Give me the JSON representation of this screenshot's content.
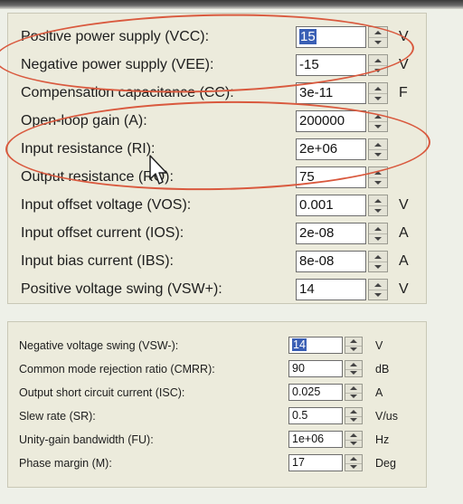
{
  "panel1": {
    "rows": [
      {
        "label": "Positive power supply (VCC):",
        "value": "15",
        "unit": "V",
        "selected": true
      },
      {
        "label": "Negative power supply (VEE):",
        "value": "-15",
        "unit": "V"
      },
      {
        "label": "Compensation capacitance (CC):",
        "value": "3e-11",
        "unit": "F"
      },
      {
        "label": "Open-loop gain (A):",
        "value": "200000",
        "unit": ""
      },
      {
        "label": "Input resistance (RI):",
        "value": "2e+06",
        "unit": ""
      },
      {
        "label": "Output resistance (RO):",
        "value": "75",
        "unit": ""
      },
      {
        "label": "Input offset voltage (VOS):",
        "value": "0.001",
        "unit": "V"
      },
      {
        "label": "Input offset current (IOS):",
        "value": "2e-08",
        "unit": "A"
      },
      {
        "label": "Input bias current (IBS):",
        "value": "8e-08",
        "unit": "A"
      },
      {
        "label": "Positive voltage swing (VSW+):",
        "value": "14",
        "unit": "V"
      }
    ]
  },
  "panel2": {
    "rows": [
      {
        "label": "Negative voltage swing (VSW-):",
        "value": "14",
        "unit": "V",
        "selected": true
      },
      {
        "label": "Common mode rejection ratio (CMRR):",
        "value": "90",
        "unit": "dB"
      },
      {
        "label": "Output short circuit current (ISC):",
        "value": "0.025",
        "unit": "A"
      },
      {
        "label": "Slew rate (SR):",
        "value": "0.5",
        "unit": "V/us"
      },
      {
        "label": "Unity-gain bandwidth (FU):",
        "value": "1e+06",
        "unit": "Hz"
      },
      {
        "label": "Phase margin (M):",
        "value": "17",
        "unit": "Deg"
      }
    ]
  },
  "colors": {
    "annotation": "#d9593e",
    "selection": "#3a5fb5",
    "panel": "#ecebdc"
  },
  "icons": {
    "cursor": "mouse-pointer-icon",
    "spinner_up": "spin-up-icon",
    "spinner_down": "spin-down-icon"
  }
}
